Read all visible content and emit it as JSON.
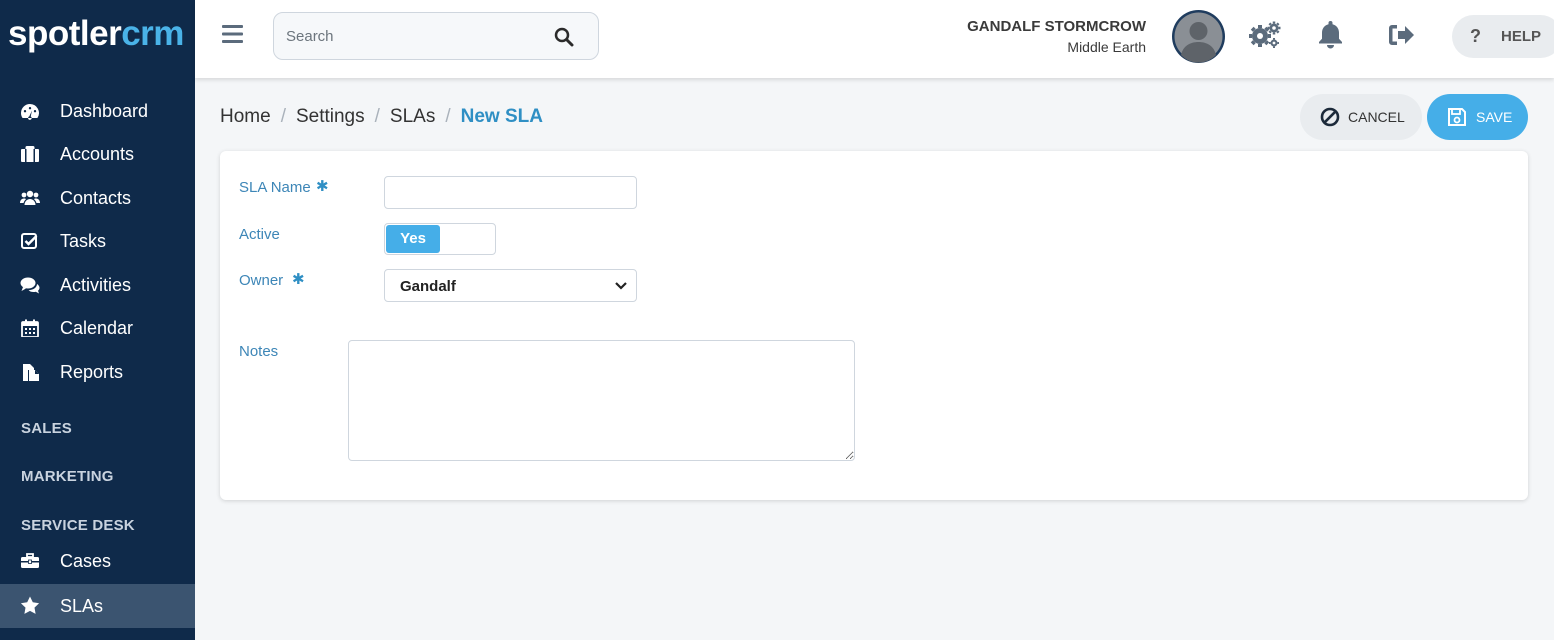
{
  "brand": {
    "logo_part1": "spotler",
    "logo_part2": "crm",
    "accent_color": "#45aee8",
    "sidebar_color": "#0f2a4a"
  },
  "sidebar": {
    "items": [
      {
        "label": "Dashboard",
        "icon": "dashboard-icon"
      },
      {
        "label": "Accounts",
        "icon": "briefcase-icon"
      },
      {
        "label": "Contacts",
        "icon": "users-icon"
      },
      {
        "label": "Tasks",
        "icon": "checkbox-icon"
      },
      {
        "label": "Activities",
        "icon": "comments-icon"
      },
      {
        "label": "Calendar",
        "icon": "calendar-icon"
      },
      {
        "label": "Reports",
        "icon": "reports-icon"
      }
    ],
    "sections": {
      "sales": "SALES",
      "marketing": "MARKETING",
      "service_desk": "SERVICE DESK"
    },
    "service_items": [
      {
        "label": "Cases",
        "icon": "toolbox-icon"
      },
      {
        "label": "SLAs",
        "icon": "star-icon",
        "active": true
      }
    ]
  },
  "header": {
    "search_placeholder": "Search",
    "user_name": "GANDALF STORMCROW",
    "user_location": "Middle Earth",
    "help_label": "HELP",
    "help_icon_text": "?"
  },
  "breadcrumb": {
    "items": [
      "Home",
      "Settings",
      "SLAs"
    ],
    "current": "New SLA"
  },
  "actions": {
    "cancel_label": "CANCEL",
    "save_label": "SAVE"
  },
  "form": {
    "sla_name_label": "SLA Name",
    "sla_name_value": "",
    "required_marker": "✱",
    "active_label": "Active",
    "active_value": "Yes",
    "owner_label": "Owner",
    "owner_value": "Gandalf",
    "notes_label": "Notes",
    "notes_value": ""
  }
}
